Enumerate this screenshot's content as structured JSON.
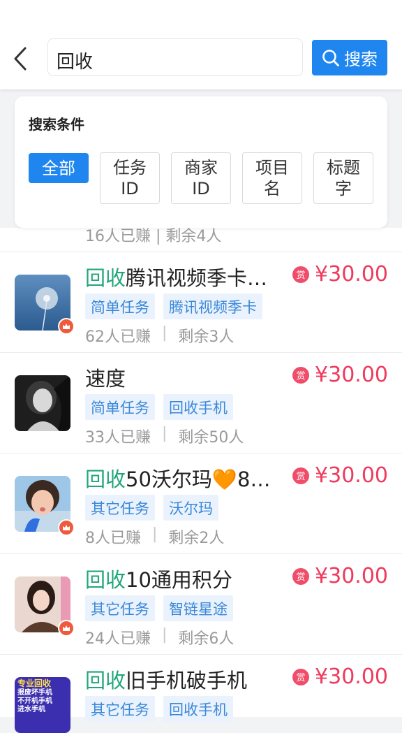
{
  "search": {
    "query": "回收",
    "button_label": "搜索"
  },
  "filter": {
    "title": "搜索条件",
    "chips": [
      {
        "label": "全部",
        "active": true
      },
      {
        "label": "任务\nID"
      },
      {
        "label": "商家\nID"
      },
      {
        "label": "项目\n名"
      },
      {
        "label": "标题\n字"
      }
    ]
  },
  "partial_row": {
    "stats": "16人已赚 | 剩余4人"
  },
  "tasks": [
    {
      "title_highlight": "回收",
      "title_rest": "腾讯视频季卡…",
      "reward_badge": "赏",
      "price": "¥30.00",
      "tags": [
        "简单任务",
        "腾讯视频季卡"
      ],
      "earned": "62人已赚",
      "remaining": "剩余3人",
      "thumb": "dandelion"
    },
    {
      "title_highlight": "",
      "title_rest": "速度",
      "reward_badge": "赏",
      "price": "¥30.00",
      "tags": [
        "简单任务",
        "回收手机"
      ],
      "earned": "33人已赚",
      "remaining": "剩余50人",
      "thumb": "portrait-bw"
    },
    {
      "title_highlight": "回收",
      "title_rest": "50沃尔玛🧡8…",
      "reward_badge": "赏",
      "price": "¥30.00",
      "tags": [
        "其它任务",
        "沃尔玛"
      ],
      "earned": "8人已赚",
      "remaining": "剩余2人",
      "thumb": "girl"
    },
    {
      "title_highlight": "回收",
      "title_rest": "10通用积分",
      "reward_badge": "赏",
      "price": "¥30.00",
      "tags": [
        "其它任务",
        "智链星途"
      ],
      "earned": "24人已赚",
      "remaining": "剩余6人",
      "thumb": "woman"
    },
    {
      "title_highlight": "回收",
      "title_rest": "旧手机破手机",
      "reward_badge": "赏",
      "price": "¥30.00",
      "tags": [
        "其它任务",
        "回收手机"
      ],
      "earned": "",
      "remaining": "",
      "thumb": "banner"
    }
  ],
  "thumb_banner_text": [
    "专业回收",
    "报废坏手机",
    "不开机手机",
    "进水手机"
  ],
  "colors": {
    "accent": "#1f86ef",
    "price": "#ef3a5d",
    "highlight": "#21a67a",
    "tag_bg": "#eaf3fd",
    "tag_text": "#3b87d8",
    "crown": "#ef5a3c"
  }
}
